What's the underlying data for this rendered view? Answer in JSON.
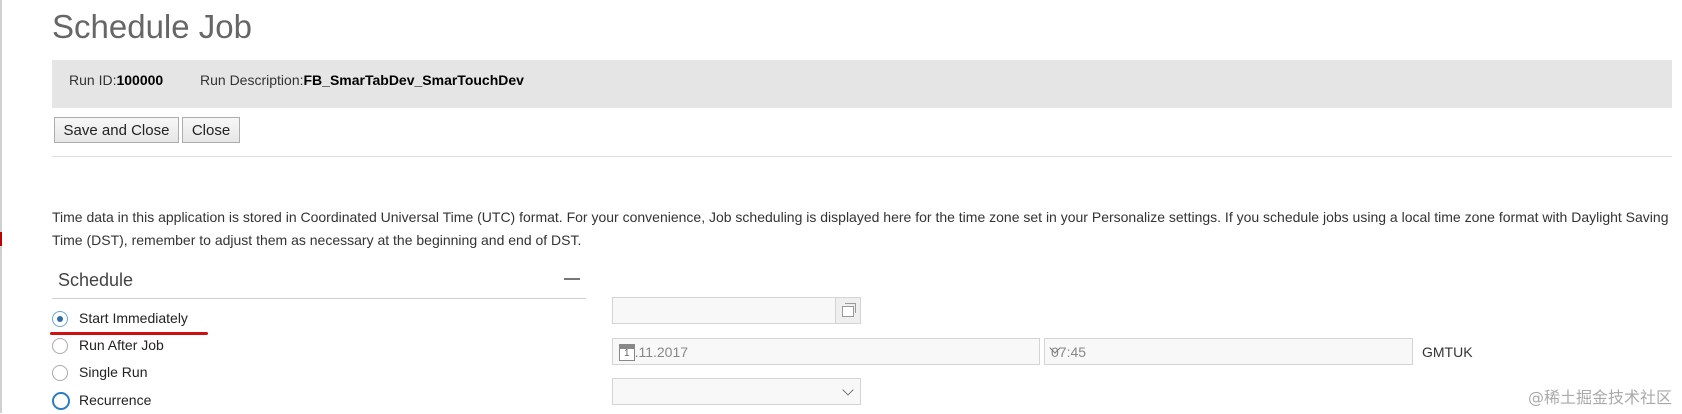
{
  "page": {
    "title": "Schedule Job"
  },
  "info_bar": {
    "run_id_label": "Run ID:",
    "run_id_value": "100000",
    "run_desc_label": "Run Description:",
    "run_desc_value": "FB_SmarTabDev_SmarTouchDev"
  },
  "toolbar": {
    "save_close_label": "Save and Close",
    "close_label": "Close"
  },
  "note": "Time data in this application is stored in Coordinated Universal Time (UTC) format. For your convenience, Job scheduling is displayed here for the time zone set in your Personalize settings. If you schedule jobs using a local time zone format with Daylight Saving Time (DST), remember to adjust them as necessary at the beginning and end of DST.",
  "schedule": {
    "title": "Schedule",
    "options": [
      {
        "label": "Start Immediately",
        "selected": true
      },
      {
        "label": "Run After Job",
        "selected": false
      },
      {
        "label": "Single Run",
        "selected": false
      },
      {
        "label": "Recurrence",
        "selected": false,
        "focused": true
      }
    ],
    "after_job_value": "",
    "date_value": "27.11.2017",
    "time_value": "07:45",
    "timezone": "GMTUK",
    "recurrence_value": ""
  },
  "watermark": "@稀土掘金技术社区",
  "colors": {
    "info_bar_bg": "#e5e5e5",
    "accent": "#2a7cc7",
    "annotation": "#d01010"
  }
}
